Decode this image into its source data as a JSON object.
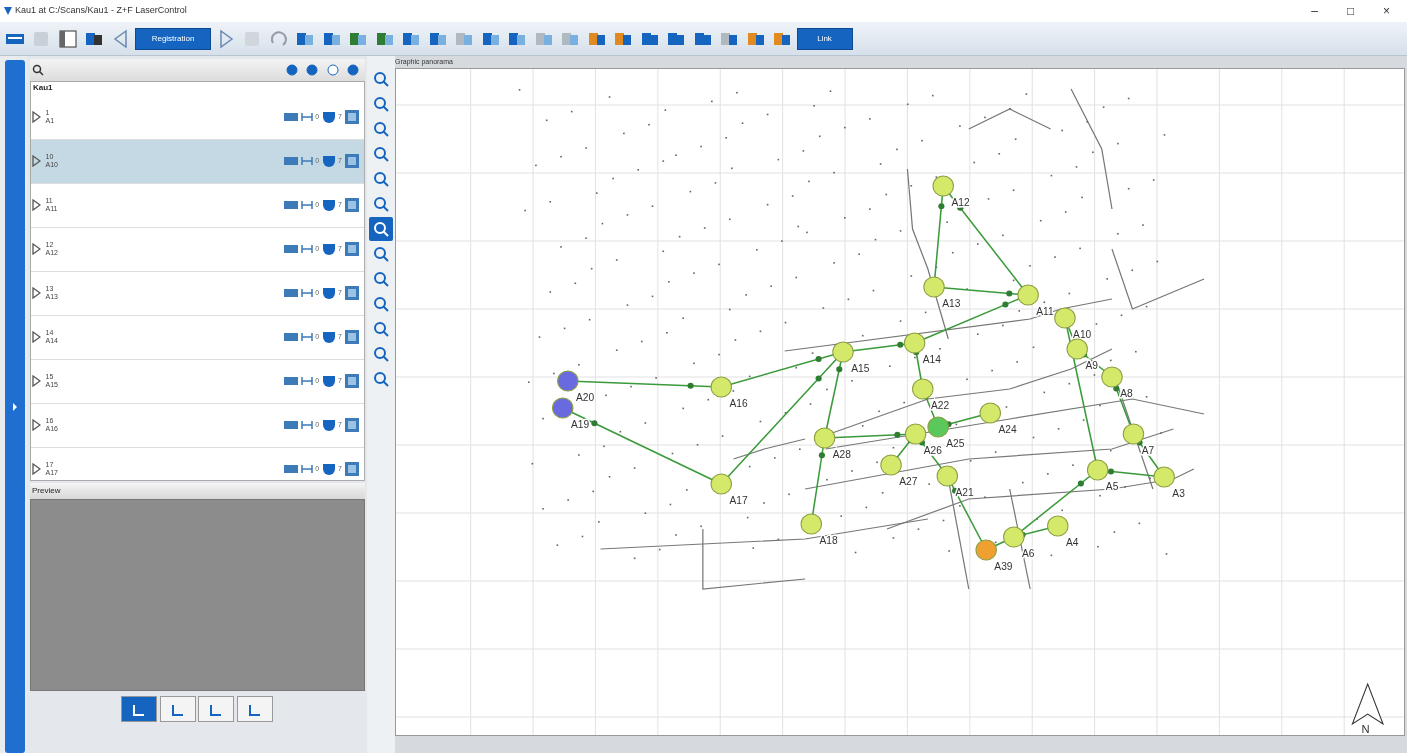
{
  "window": {
    "title": "Kau1 at C:/Scans/Kau1 - Z+F LaserControl",
    "controls": [
      "–",
      "□",
      "×"
    ]
  },
  "toolbar": {
    "mode_button": "Registration",
    "link_button": "Link"
  },
  "project_tree": {
    "root": "Kau1",
    "items": [
      {
        "number": "1",
        "name": "A1",
        "selected": false,
        "count_a": "0",
        "count_b": "7"
      },
      {
        "number": "10",
        "name": "A10",
        "selected": true,
        "count_a": "0",
        "count_b": "7"
      },
      {
        "number": "11",
        "name": "A11",
        "selected": false,
        "count_a": "0",
        "count_b": "7"
      },
      {
        "number": "12",
        "name": "A12",
        "selected": false,
        "count_a": "0",
        "count_b": "7"
      },
      {
        "number": "13",
        "name": "A13",
        "selected": false,
        "count_a": "0",
        "count_b": "7"
      },
      {
        "number": "14",
        "name": "A14",
        "selected": false,
        "count_a": "0",
        "count_b": "7"
      },
      {
        "number": "15",
        "name": "A15",
        "selected": false,
        "count_a": "0",
        "count_b": "7"
      },
      {
        "number": "16",
        "name": "A16",
        "selected": false,
        "count_a": "0",
        "count_b": "7"
      },
      {
        "number": "17",
        "name": "A17",
        "selected": false,
        "count_a": "0",
        "count_b": "7"
      }
    ]
  },
  "preview": {
    "title": "Preview"
  },
  "bottom_tabs": [
    {
      "selected": true
    },
    {
      "selected": false
    },
    {
      "selected": false
    },
    {
      "selected": false
    }
  ],
  "side_tools": [
    {
      "selected": false
    },
    {
      "selected": false
    },
    {
      "selected": false
    },
    {
      "selected": false
    },
    {
      "selected": false
    },
    {
      "selected": false
    },
    {
      "selected": true
    },
    {
      "selected": false
    },
    {
      "selected": false
    },
    {
      "selected": false
    },
    {
      "selected": false
    },
    {
      "selected": false
    },
    {
      "selected": false
    }
  ],
  "map": {
    "title": "Graphic panorama",
    "north_label": "N",
    "stations": [
      {
        "label": "A12",
        "color": "#d4e96a"
      },
      {
        "label": "A13",
        "color": "#d4e96a"
      },
      {
        "label": "A11",
        "color": "#d4e96a"
      },
      {
        "label": "A10",
        "color": "#d4e96a"
      },
      {
        "label": "A14",
        "color": "#d4e96a"
      },
      {
        "label": "A15",
        "color": "#d4e96a"
      },
      {
        "label": "A16",
        "color": "#d4e96a"
      },
      {
        "label": "A20",
        "color": "#6a6ae0"
      },
      {
        "label": "A19",
        "color": "#6a6ae0"
      },
      {
        "label": "A9",
        "color": "#d4e96a"
      },
      {
        "label": "A8",
        "color": "#d4e96a"
      },
      {
        "label": "A7",
        "color": "#d4e96a"
      },
      {
        "label": "A17",
        "color": "#d4e96a"
      },
      {
        "label": "A18",
        "color": "#d4e96a"
      },
      {
        "label": "A28",
        "color": "#d4e96a"
      },
      {
        "label": "A26",
        "color": "#d4e96a"
      },
      {
        "label": "A25",
        "color": "#5ac85a"
      },
      {
        "label": "A24",
        "color": "#d4e96a"
      },
      {
        "label": "A27",
        "color": "#d4e96a"
      },
      {
        "label": "A22",
        "color": "#d4e96a"
      },
      {
        "label": "A21",
        "color": "#d4e96a"
      },
      {
        "label": "A5",
        "color": "#d4e96a"
      },
      {
        "label": "A3",
        "color": "#d4e96a"
      },
      {
        "label": "A4",
        "color": "#d4e96a"
      },
      {
        "label": "A6",
        "color": "#d4e96a"
      },
      {
        "label": "A39",
        "color": "#f0a030"
      }
    ]
  }
}
